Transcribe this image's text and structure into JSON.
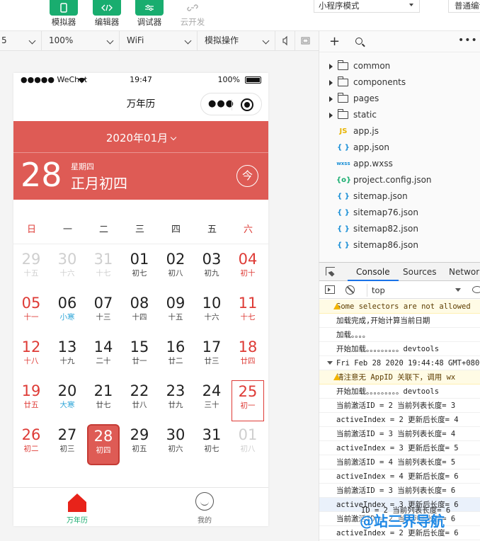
{
  "toolbar": {
    "buttons": [
      {
        "label": "模拟器",
        "icon": "phone-icon"
      },
      {
        "label": "编辑器",
        "icon": "code-icon"
      },
      {
        "label": "调试器",
        "icon": "sliders-icon"
      },
      {
        "label": "云开发",
        "icon": "cloud-icon"
      }
    ],
    "mode_value": "小程序模式",
    "compile_value": "普通编译"
  },
  "simbar": {
    "device_value": "5",
    "zoom_value": "100%",
    "network_value": "WiFi",
    "operation_value": "模拟操作"
  },
  "phone": {
    "status": {
      "carrier": "●●●●● WeChat",
      "time": "19:47",
      "battery": "100%"
    },
    "nav_title": "万年历",
    "header": {
      "month": "2020年01月",
      "day": "28",
      "weekday": "星期四",
      "lunar": "正月初四",
      "today_label": "今"
    },
    "weekdays": [
      "日",
      "一",
      "二",
      "三",
      "四",
      "五",
      "六"
    ],
    "days": [
      {
        "n": "29",
        "l": "十五",
        "t": "other"
      },
      {
        "n": "30",
        "l": "十六",
        "t": "other"
      },
      {
        "n": "31",
        "l": "十七",
        "t": "other"
      },
      {
        "n": "01",
        "l": "初七",
        "t": ""
      },
      {
        "n": "02",
        "l": "初八",
        "t": ""
      },
      {
        "n": "03",
        "l": "初九",
        "t": ""
      },
      {
        "n": "04",
        "l": "初十",
        "t": "weekend"
      },
      {
        "n": "05",
        "l": "十一",
        "t": "weekend"
      },
      {
        "n": "06",
        "l": "小寒",
        "t": "term"
      },
      {
        "n": "07",
        "l": "十三",
        "t": ""
      },
      {
        "n": "08",
        "l": "十四",
        "t": ""
      },
      {
        "n": "09",
        "l": "十五",
        "t": ""
      },
      {
        "n": "10",
        "l": "十六",
        "t": ""
      },
      {
        "n": "11",
        "l": "十七",
        "t": "weekend"
      },
      {
        "n": "12",
        "l": "十八",
        "t": "weekend"
      },
      {
        "n": "13",
        "l": "十九",
        "t": ""
      },
      {
        "n": "14",
        "l": "二十",
        "t": ""
      },
      {
        "n": "15",
        "l": "廿一",
        "t": ""
      },
      {
        "n": "16",
        "l": "廿二",
        "t": ""
      },
      {
        "n": "17",
        "l": "廿三",
        "t": ""
      },
      {
        "n": "18",
        "l": "廿四",
        "t": "weekend"
      },
      {
        "n": "19",
        "l": "廿五",
        "t": "weekend"
      },
      {
        "n": "20",
        "l": "大寒",
        "t": "term"
      },
      {
        "n": "21",
        "l": "廿七",
        "t": ""
      },
      {
        "n": "22",
        "l": "廿八",
        "t": ""
      },
      {
        "n": "23",
        "l": "廿九",
        "t": ""
      },
      {
        "n": "24",
        "l": "三十",
        "t": ""
      },
      {
        "n": "25",
        "l": "初一",
        "t": "weekend selected"
      },
      {
        "n": "26",
        "l": "初二",
        "t": "weekend"
      },
      {
        "n": "27",
        "l": "初三",
        "t": ""
      },
      {
        "n": "28",
        "l": "初四",
        "t": "today"
      },
      {
        "n": "29",
        "l": "初五",
        "t": ""
      },
      {
        "n": "30",
        "l": "初六",
        "t": ""
      },
      {
        "n": "31",
        "l": "初七",
        "t": ""
      },
      {
        "n": "01",
        "l": "初八",
        "t": "other"
      }
    ],
    "tabs": [
      {
        "label": "万年历",
        "icon": "calendar-home-icon",
        "active": true
      },
      {
        "label": "我的",
        "icon": "profile-smile-icon",
        "active": false
      }
    ]
  },
  "explorer": {
    "folders": [
      "common",
      "components",
      "pages",
      "static"
    ],
    "files": [
      {
        "name": "app.js",
        "icon": "JS",
        "color": "#e8b400"
      },
      {
        "name": "app.json",
        "icon": "{ }",
        "color": "#1a8fd6"
      },
      {
        "name": "app.wxss",
        "icon": "wxss",
        "color": "#1a8fd6"
      },
      {
        "name": "project.config.json",
        "icon": "{o}",
        "color": "#19ad6f"
      },
      {
        "name": "sitemap.json",
        "icon": "{ }",
        "color": "#1a8fd6"
      },
      {
        "name": "sitemap76.json",
        "icon": "{ }",
        "color": "#1a8fd6"
      },
      {
        "name": "sitemap82.json",
        "icon": "{ }",
        "color": "#1a8fd6"
      },
      {
        "name": "sitemap86.json",
        "icon": "{ }",
        "color": "#1a8fd6"
      }
    ]
  },
  "devtools": {
    "tabs": [
      "Console",
      "Sources",
      "Network"
    ],
    "context_value": "top",
    "logs": [
      {
        "text": "Some selectors are not allowed",
        "kind": "warn"
      },
      {
        "text": "加载完成,开始计算当前日期",
        "kind": ""
      },
      {
        "text": "加载。。。。",
        "kind": ""
      },
      {
        "text": "开始加载。。。。。。。。。devtools",
        "kind": ""
      },
      {
        "text": "Fri Feb 28 2020 19:44:48 GMT+0800",
        "kind": "group"
      },
      {
        "text": "请注意无 AppID 关联下，调用 wx",
        "kind": "warn"
      },
      {
        "text": "开始加载。。。。。。。。。devtools",
        "kind": ""
      },
      {
        "text": "当前激活ID = 2  当前列表长度= 3",
        "kind": ""
      },
      {
        "text": "activeIndex = 2 更新后长度= 4",
        "kind": ""
      },
      {
        "text": "当前激活ID = 3  当前列表长度= 4",
        "kind": ""
      },
      {
        "text": "activeIndex = 3 更新后长度= 5",
        "kind": ""
      },
      {
        "text": "当前激活ID = 4  当前列表长度= 5",
        "kind": ""
      },
      {
        "text": "activeIndex = 4 更新后长度= 6",
        "kind": ""
      },
      {
        "text": "当前激活ID = 3  当前列表长度= 6",
        "kind": ""
      },
      {
        "text": "activeIndex = 3 更新后长度= 6",
        "kind": "hl"
      },
      {
        "text": "当前激活ID = 2  当前列表长度= 6",
        "kind": ""
      },
      {
        "text": "activeIndex = 2 更新后长度= 6",
        "kind": ""
      }
    ],
    "overlay_log": "ID = 2  当前列表长度= 6"
  },
  "watermark": "@站三界导航"
}
